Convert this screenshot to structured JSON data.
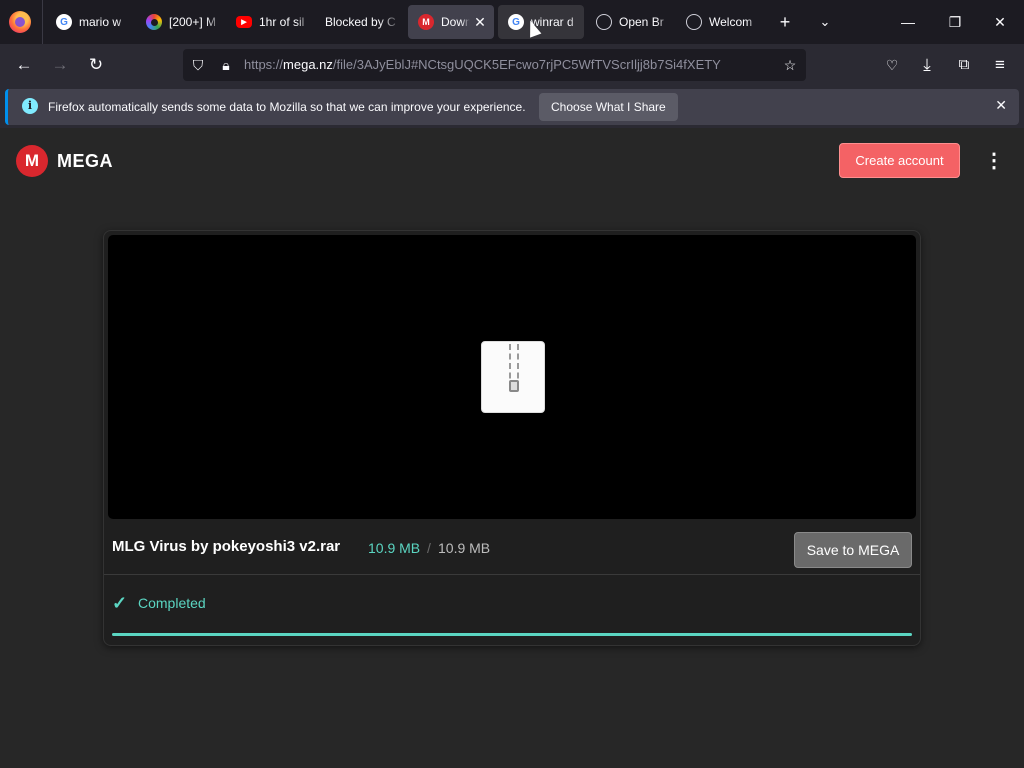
{
  "tabs": [
    {
      "label": "mario w",
      "favicon": "google-icon"
    },
    {
      "label": "[200+] M",
      "favicon": "color-ring-icon"
    },
    {
      "label": "1hr of sil",
      "favicon": "youtube-icon"
    },
    {
      "label": "Blocked by C",
      "favicon": "none"
    },
    {
      "label": "Down",
      "favicon": "mega-icon",
      "active": true
    },
    {
      "label": "winrar d",
      "favicon": "google-icon"
    },
    {
      "label": "Open Br",
      "favicon": "globe-icon"
    },
    {
      "label": "Welcom",
      "favicon": "globe-icon"
    }
  ],
  "addressbar": {
    "url_prefix": "https://",
    "url_host": "mega.nz",
    "url_path": "/file/3AJyEblJ#NCtsgUQCK5EFcwo7rjPC5WfTVScrIljj8b7Si4fXETY"
  },
  "notification": {
    "text": "Firefox automatically sends some data to Mozilla so that we can improve your experience.",
    "button": "Choose What I Share"
  },
  "mega": {
    "logo_letter": "M",
    "logo_text": "MEGA",
    "create_account": "Create account",
    "file_name": "MLG Virus by pokeyoshi3 v2.rar",
    "size_done": "10.9 MB",
    "size_separator": "/",
    "size_total": "10.9 MB",
    "save_button": "Save to MEGA",
    "status": "Completed",
    "progress": 1.0
  },
  "colors": {
    "mega_red": "#d9272e",
    "accent_teal": "#5bd6c2",
    "create_button": "#f46265"
  }
}
